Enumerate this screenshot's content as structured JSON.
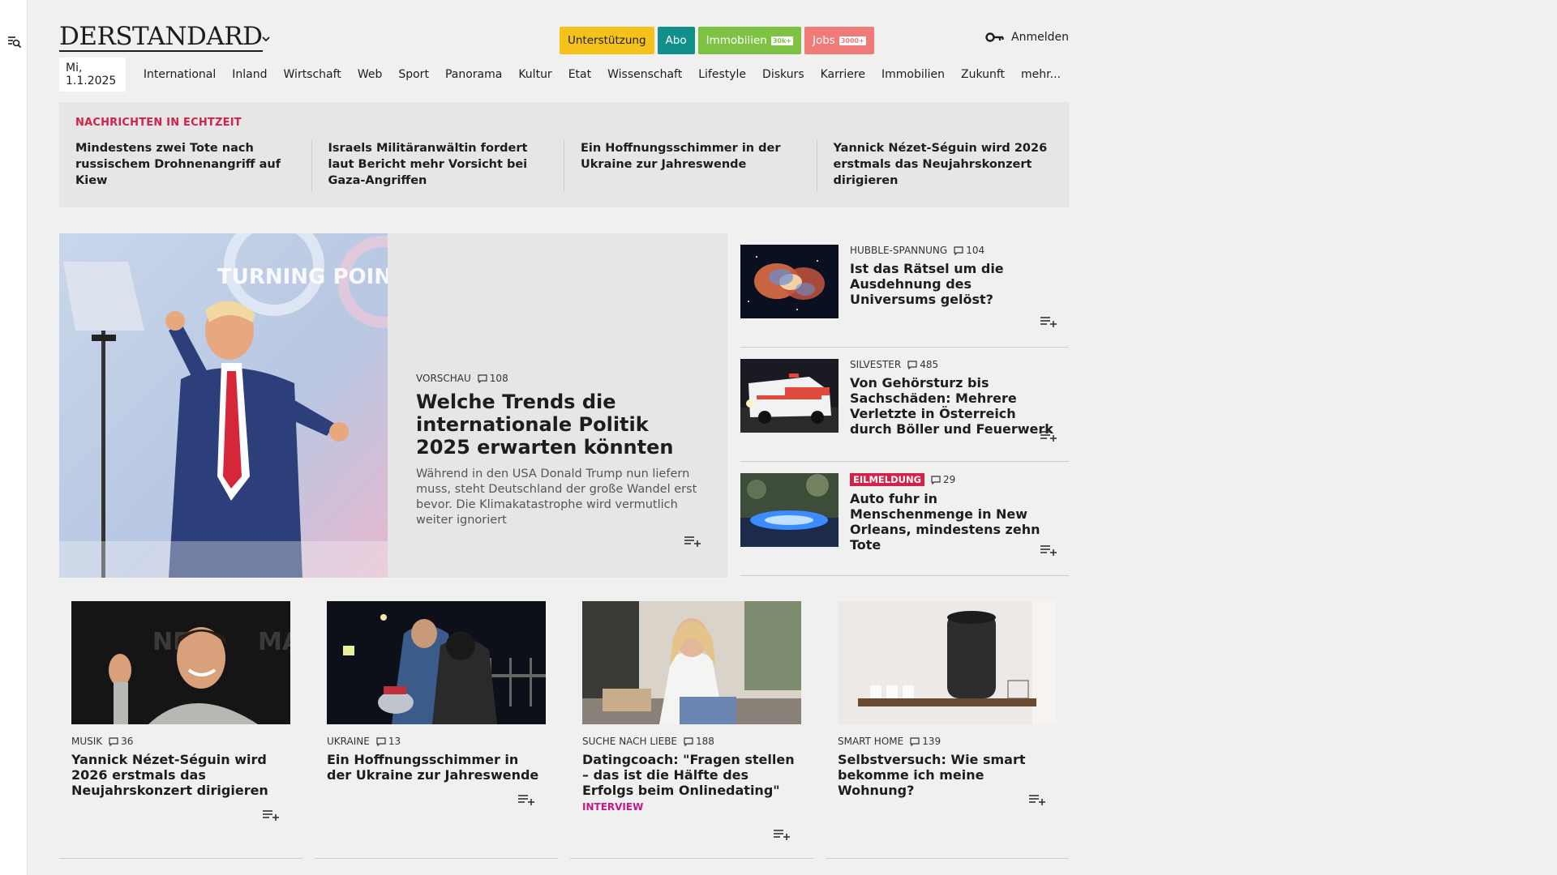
{
  "header": {
    "logo": "DERSTANDARD",
    "promo": {
      "support": "Unterstützung",
      "abo": "Abo",
      "immobilien": "Immobilien",
      "immobilien_badge": "30k+",
      "jobs": "Jobs",
      "jobs_badge": "3000+"
    },
    "login": "Anmelden"
  },
  "nav": {
    "date": "Mi, 1.1.2025",
    "items": [
      "International",
      "Inland",
      "Wirtschaft",
      "Web",
      "Sport",
      "Panorama",
      "Kultur",
      "Etat",
      "Wissenschaft",
      "Lifestyle",
      "Diskurs",
      "Karriere",
      "Immobilien",
      "Zukunft",
      "mehr..."
    ]
  },
  "ticker": {
    "label": "NACHRICHTEN IN ECHTZEIT",
    "items": [
      "Mindestens zwei Tote nach russi­schem Drohnenangriff auf Kiew",
      "Israels Militäranwältin fordert laut Bericht mehr Vorsicht bei Gaza-Angriffen",
      "Ein Hoffnungsschimmer in der Ukraine zur Jahreswende",
      "Yannick Nézet-Séguin wird 2026 erst­mals das Neujahrskonzert dirigieren"
    ]
  },
  "hero": {
    "kicker": "VORSCHAU",
    "comments": "108",
    "title": "Welche Trends die internationale Politik 2025 erwarten könnten",
    "teaser": "Während in den USA Donald Trump nun liefern muss, steht Deutschland der große Wandel erst bevor. Die Klimakatastrophe wird vermutlich weiter ignoriert",
    "image_text": "TURNING POINT USA"
  },
  "side": [
    {
      "kicker": "HUBBLE-SPANNUNG",
      "comments": "104",
      "title": "Ist das Rätsel um die Ausdehnung des Universums gelöst?"
    },
    {
      "kicker": "SILVESTER",
      "comments": "485",
      "title": "Von Gehörsturz bis Sachschäden: Mehrere Verletzte in Österreich durch Böller und Feuerwerk"
    },
    {
      "kicker": "EILMELDUNG",
      "comments": "29",
      "title": "Auto fuhr in Menschenmenge in New Orleans, mindestens zehn Tote"
    }
  ],
  "cards": [
    {
      "kicker": "MUSIK",
      "comments": "36",
      "title": "Yannick Nézet-Séguin wird 2026 erstmals das Neujahrskonzert dirigieren",
      "tag": ""
    },
    {
      "kicker": "UKRAINE",
      "comments": "13",
      "title": "Ein Hoffnungsschimmer in der Ukraine zur Jahreswende",
      "tag": ""
    },
    {
      "kicker": "SUCHE NACH LIEBE",
      "comments": "188",
      "title": "Datingcoach: \"Fragen stellen – das ist die Hälfte des Erfolgs beim Onlinedating\"",
      "tag": "INTERVIEW"
    },
    {
      "kicker": "SMART HOME",
      "comments": "139",
      "title": "Selbstversuch: Wie smart bekomme ich meine Wohnung?",
      "tag": ""
    }
  ],
  "colors": {
    "accent_red": "#d3224a",
    "support": "#f5c21b",
    "abo": "#118f8a",
    "immobilien": "#7dc242",
    "jobs": "#f07a77",
    "interview": "#c2188b"
  },
  "icons": {
    "menu": "search-menu-icon",
    "login": "key-icon",
    "comments": "comment-bubble-icon",
    "watch": "playlist-add-icon",
    "dropdown": "chevron-down-icon"
  }
}
